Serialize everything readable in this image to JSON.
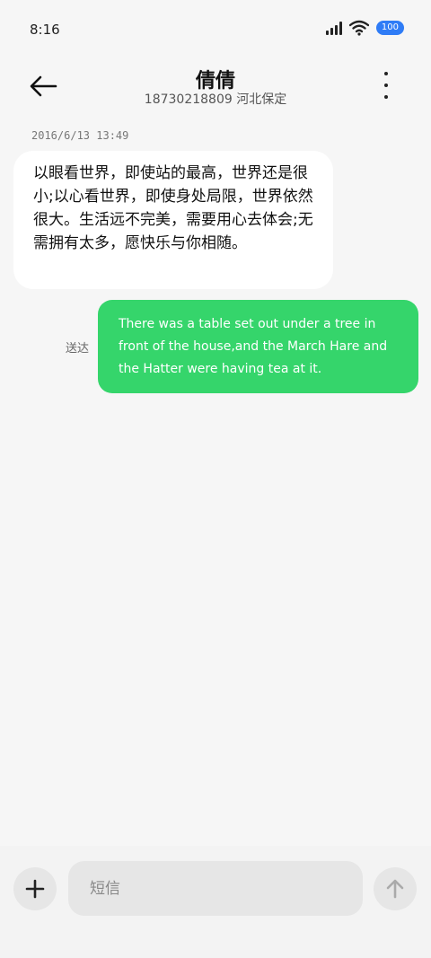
{
  "status_bar": {
    "time": "8:16",
    "battery": "100",
    "battery_color": "#2f7cf6"
  },
  "header": {
    "name": "倩倩",
    "subtitle": "18730218809 河北保定",
    "back_icon": "arrow-left-icon",
    "more_icon": "more-vertical-icon"
  },
  "conversation": {
    "timestamp": "2016/6/13 13:49",
    "incoming": {
      "text": "以眼看世界，即使站的最高，世界还是很小;以心看世界，即使身处局限，世界依然很大。生活远不完美，需要用心去体会;无需拥有太多，愿快乐与你相随。"
    },
    "outgoing": {
      "status": "送达",
      "text": "There was a table set out under a tree in front of the house,and the March Hare and the Hatter were having tea at it.",
      "bubble_color": "#35d56b"
    }
  },
  "composer": {
    "placeholder": "短信",
    "add_icon": "plus-icon",
    "send_icon": "arrow-up-icon"
  }
}
